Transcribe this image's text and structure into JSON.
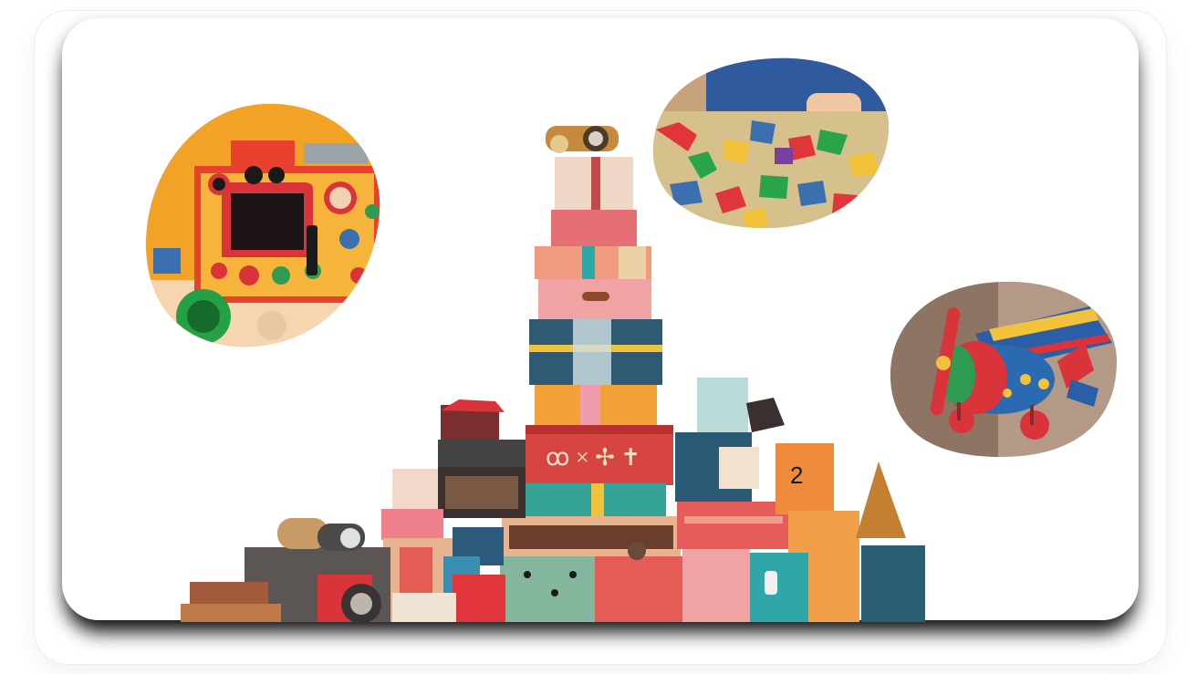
{
  "scene": {
    "description_free": true,
    "palette": {
      "background": "#ffffff",
      "shadow": "#000000",
      "orange": "#f4a52a",
      "red": "#d9343a",
      "pink": "#ec8a86",
      "teal": "#2f6f73",
      "navy": "#254b66",
      "yellow": "#f2c23a",
      "blue": "#3b6fb0",
      "green": "#2e9b52"
    },
    "box_number": "2",
    "icons": [
      "toy-stove-photo",
      "puzzle-photo",
      "toy-plane-photo",
      "toy-box-tower"
    ]
  }
}
